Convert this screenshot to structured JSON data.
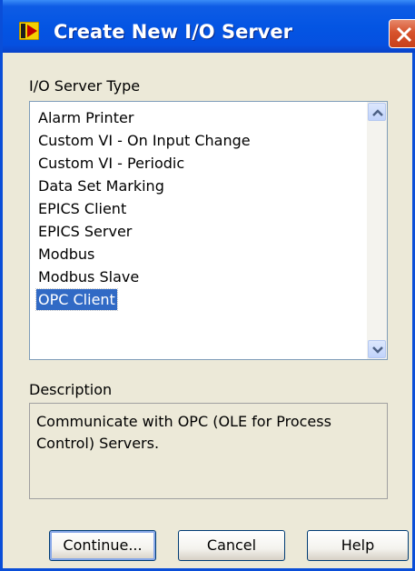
{
  "window": {
    "title": "Create New I/O Server",
    "close_icon": "close-icon"
  },
  "server_type": {
    "label": "I/O Server Type",
    "items": [
      "Alarm Printer",
      "Custom VI - On Input Change",
      "Custom VI - Periodic",
      "Data Set Marking",
      "EPICS Client",
      "EPICS Server",
      "Modbus",
      "Modbus Slave",
      "OPC Client"
    ],
    "selected": "OPC Client"
  },
  "description": {
    "label": "Description",
    "text": "Communicate with OPC (OLE for Process Control) Servers."
  },
  "buttons": {
    "continue": "Continue...",
    "cancel": "Cancel",
    "help": "Help"
  },
  "colors": {
    "titlebar": "#0455E3",
    "selection": "#316AC5",
    "dialog_bg": "#ECE9D8"
  }
}
